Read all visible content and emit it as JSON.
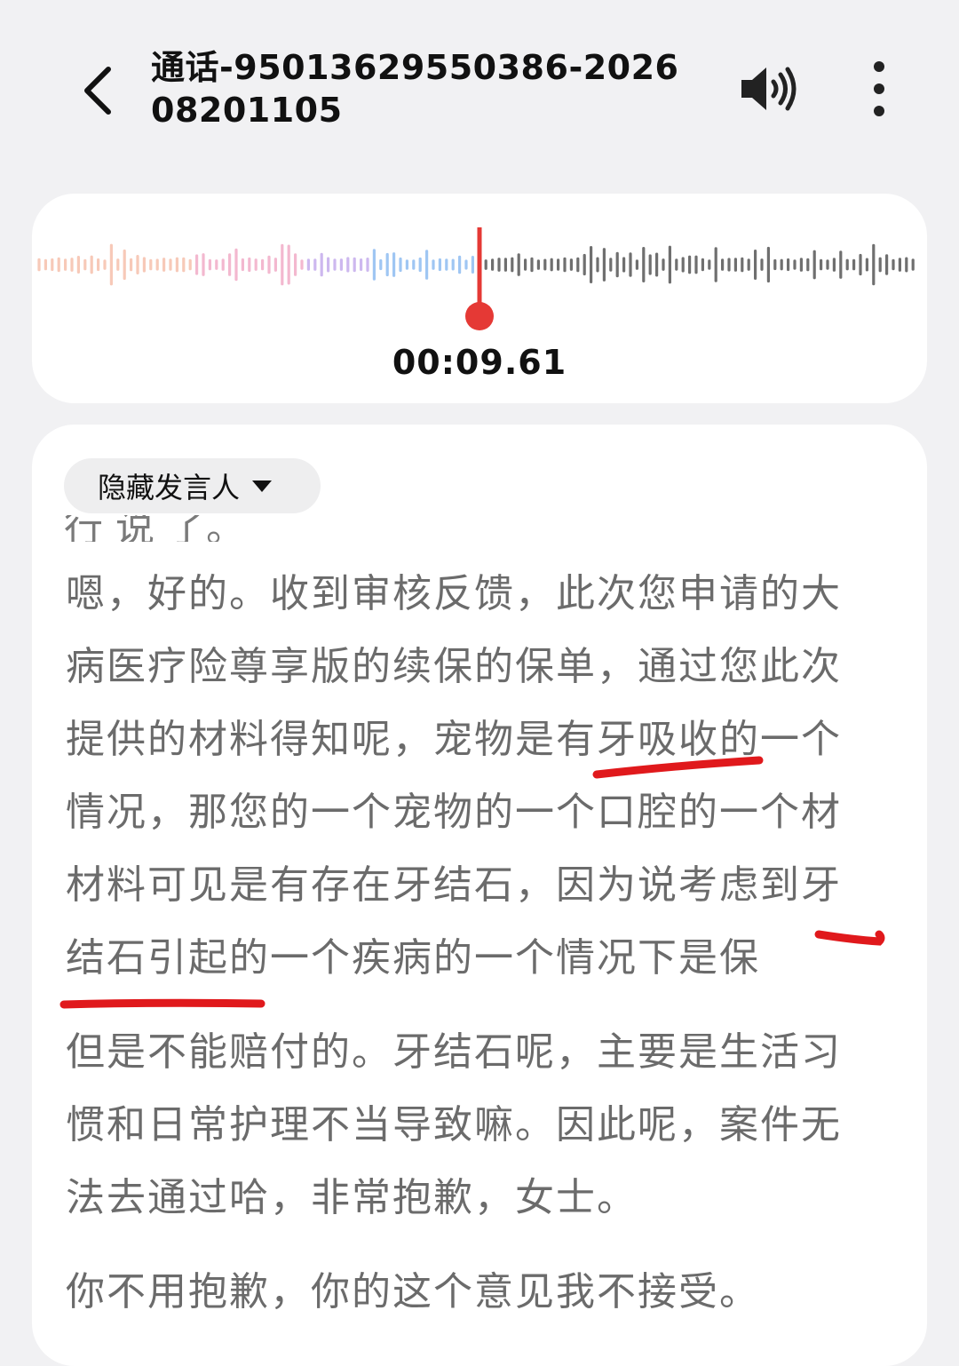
{
  "header": {
    "title": "通话-95013629550386-202608201105",
    "back_icon": "chevron-left-icon",
    "speaker_icon": "speaker-icon",
    "more_icon": "more-vertical-icon"
  },
  "player": {
    "current_time": "00:09.61",
    "playhead_color": "#e53935"
  },
  "transcript": {
    "speaker_toggle_label": "隐藏发言人",
    "cut_line": "行 说 了。",
    "paragraph1_lines": [
      "嗯，好的。收到审核反馈，此次您申请的大",
      "病医疗险尊享版的续保的保单，通过您此次",
      "提供的材料得知呢，宠物是有牙吸收的一个",
      "情况，那您的一个宠物的一个口腔的一个材",
      "材料可见是有存在牙结石，因为说考虑到牙",
      "结石引起的一个疾病的一个情况下是保"
    ],
    "paragraph2_lines": [
      "但是不能赔付的。牙结石呢，主要是生活习",
      "惯和日常护理不当导致嘛。因此呢，案件无",
      "法去通过哈，非常抱歉，女士。"
    ],
    "paragraph3_lines": [
      "你不用抱歉，你的这个意见我不接受。"
    ]
  },
  "colors": {
    "annotation_red": "#e0191c",
    "text_gray": "#6b6b6b"
  }
}
